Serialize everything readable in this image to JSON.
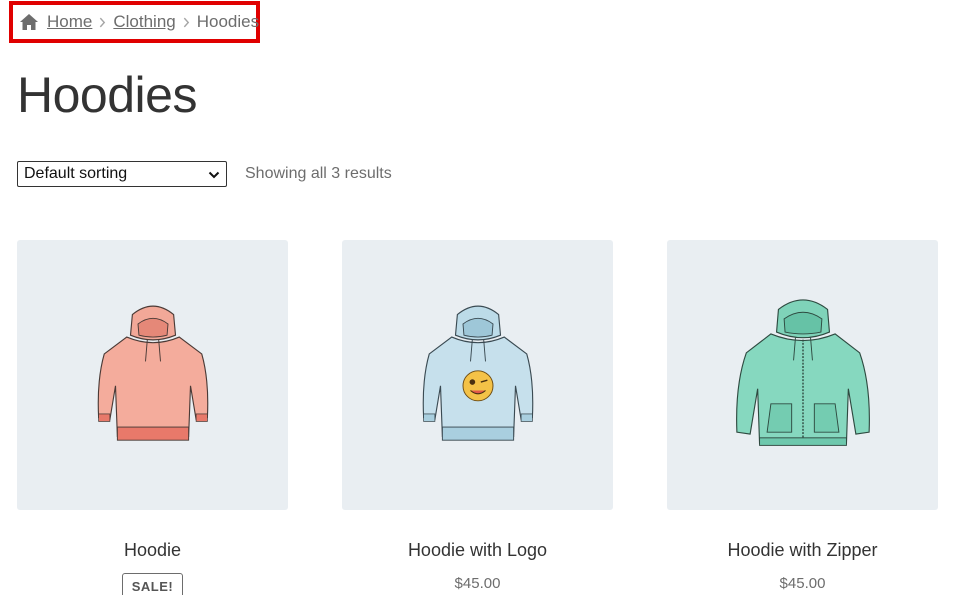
{
  "breadcrumb": {
    "home_label": "Home",
    "category_label": "Clothing",
    "current_label": "Hoodies",
    "highlight_color": "#e00000"
  },
  "page": {
    "title": "Hoodies"
  },
  "toolbar": {
    "sort_selected": "Default sorting",
    "result_count": "Showing all 3 results"
  },
  "products": [
    {
      "name": "Hoodie",
      "badge": "SALE!",
      "color": "#f2a898",
      "icon": "hoodie-image"
    },
    {
      "name": "Hoodie with Logo",
      "price": "$45.00",
      "color": "#bcdbe8",
      "icon": "hoodie-with-logo-image"
    },
    {
      "name": "Hoodie with Zipper",
      "price": "$45.00",
      "color": "#7fd3b9",
      "icon": "hoodie-with-zipper-image"
    }
  ]
}
